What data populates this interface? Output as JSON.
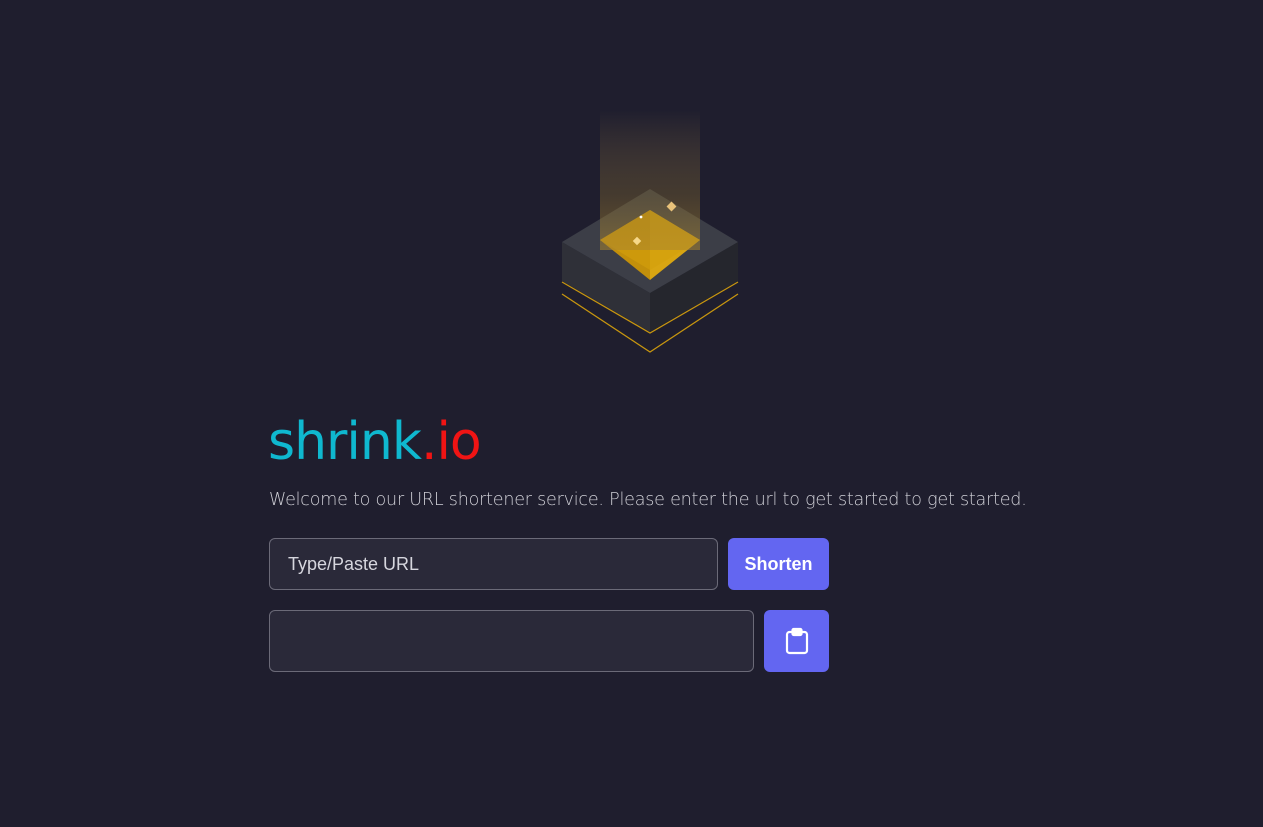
{
  "brand": {
    "name": "shrink",
    "tld": ".io"
  },
  "tagline": "Welcome to our URL shortener service. Please enter the url to get started to get started.",
  "form": {
    "url_placeholder": "Type/Paste URL",
    "url_value": "",
    "shorten_label": "Shorten",
    "result_value": ""
  },
  "icons": {
    "hero": "box-with-light-beam-illustration",
    "copy": "clipboard-icon"
  },
  "colors": {
    "background": "#1f1e2e",
    "brand_name": "#0fb8cf",
    "brand_tld": "#f01414",
    "accent": "#6366f1",
    "gold": "#d4a00c"
  }
}
